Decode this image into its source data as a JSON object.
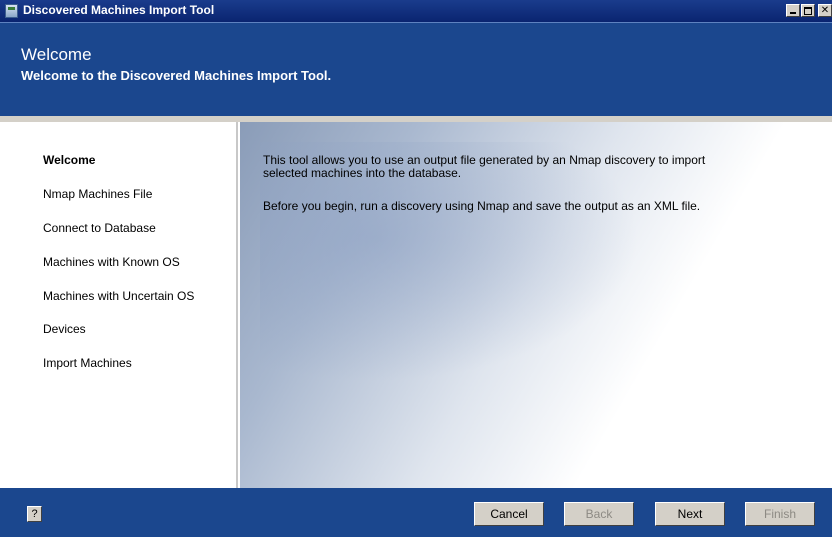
{
  "window": {
    "title": "Discovered Machines Import Tool"
  },
  "header": {
    "title": "Welcome",
    "subtitle": "Welcome to the Discovered Machines Import Tool."
  },
  "nav": {
    "items": [
      {
        "label": "Welcome",
        "active": true
      },
      {
        "label": "Nmap Machines File"
      },
      {
        "label": "Connect to Database"
      },
      {
        "label": "Machines with Known OS"
      },
      {
        "label": "Machines with Uncertain OS"
      },
      {
        "label": "Devices"
      },
      {
        "label": "Import Machines"
      }
    ]
  },
  "content": {
    "p1": "This tool allows you to use an output file generated by an Nmap discovery to import selected machines into the database.",
    "p2": "Before you begin, run a discovery using Nmap and save the output as an XML file."
  },
  "footer": {
    "help_label": "?",
    "cancel": "Cancel",
    "back": "Back",
    "next": "Next",
    "finish": "Finish"
  }
}
